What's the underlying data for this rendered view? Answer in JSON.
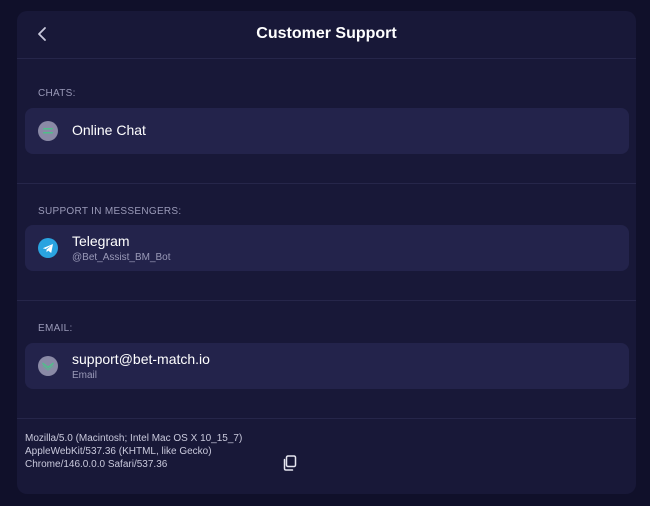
{
  "header": {
    "title": "Customer Support"
  },
  "sections": [
    {
      "label": "CHATS:",
      "items": [
        {
          "title": "Online Chat",
          "icon": "chat-icon"
        }
      ]
    },
    {
      "label": "SUPPORT IN MESSENGERS:",
      "items": [
        {
          "title": "Telegram",
          "subtitle": "@Bet_Assist_BM_Bot",
          "icon": "telegram-icon"
        }
      ]
    },
    {
      "label": "EMAIL:",
      "items": [
        {
          "title": "support@bet-match.io",
          "subtitle": "Email",
          "icon": "email-icon"
        }
      ]
    }
  ],
  "footer": {
    "user_agent_lines": [
      "Mozilla/5.0 (Macintosh; Intel Mac OS X 10_15_7)",
      "AppleWebKit/537.36 (KHTML, like Gecko)",
      "Chrome/146.0.0.0 Safari/537.36"
    ],
    "copy_icon": "copy-icon"
  },
  "colors": {
    "background": "#10102a",
    "panel": "#181838",
    "card": "#23234b",
    "muted_text": "#9a9ab8",
    "telegram_blue": "#2aa3e0",
    "accent_green": "#4fbf8a"
  }
}
